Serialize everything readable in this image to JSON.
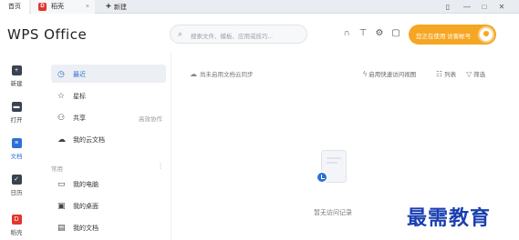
{
  "tabs": {
    "home": "首页",
    "doc": "稻壳",
    "doc_logo": "D",
    "new": "新建",
    "new_icon": "plus-icon"
  },
  "window_controls": [
    "▯",
    "—",
    "□",
    "✕"
  ],
  "header": {
    "logo": "WPS Office",
    "search_placeholder": "搜索文件、模板、应用或技巧...",
    "login_label": "您正在使用 访客帐号",
    "icons": [
      "headset-icon",
      "shirt-icon",
      "gear-icon",
      "message-icon"
    ]
  },
  "rail": [
    {
      "label": "新建",
      "icon": "+"
    },
    {
      "label": "打开",
      "icon": "▬"
    },
    {
      "label": "文档",
      "icon": "≡"
    },
    {
      "label": "日历",
      "icon": "✓"
    },
    {
      "label": "稻壳",
      "icon": "D"
    }
  ],
  "nav": {
    "items": [
      {
        "label": "最近",
        "icon": "◷",
        "extra": ""
      },
      {
        "label": "星标",
        "icon": "☆",
        "extra": ""
      },
      {
        "label": "共享",
        "icon": "⚇",
        "extra": "高效协作"
      },
      {
        "label": "我的云文档",
        "icon": "☁",
        "extra": ""
      }
    ],
    "section_label": "常用",
    "section_more": "⋮",
    "common_items": [
      {
        "label": "我的电脑",
        "icon": "▭"
      },
      {
        "label": "我的桌面",
        "icon": "▣"
      },
      {
        "label": "我的文档",
        "icon": "▤"
      }
    ]
  },
  "main": {
    "sync_text": "尚未启用文档云同步",
    "quick_access": "启用快速访问视图",
    "list_label": "列表",
    "filter_label": "筛选",
    "empty_text": "暂无访问记录"
  },
  "watermark": "最需教育",
  "colors": {
    "accent": "#2e6fd6",
    "login_bg": "#f5a623",
    "brand_red": "#e2362d"
  }
}
